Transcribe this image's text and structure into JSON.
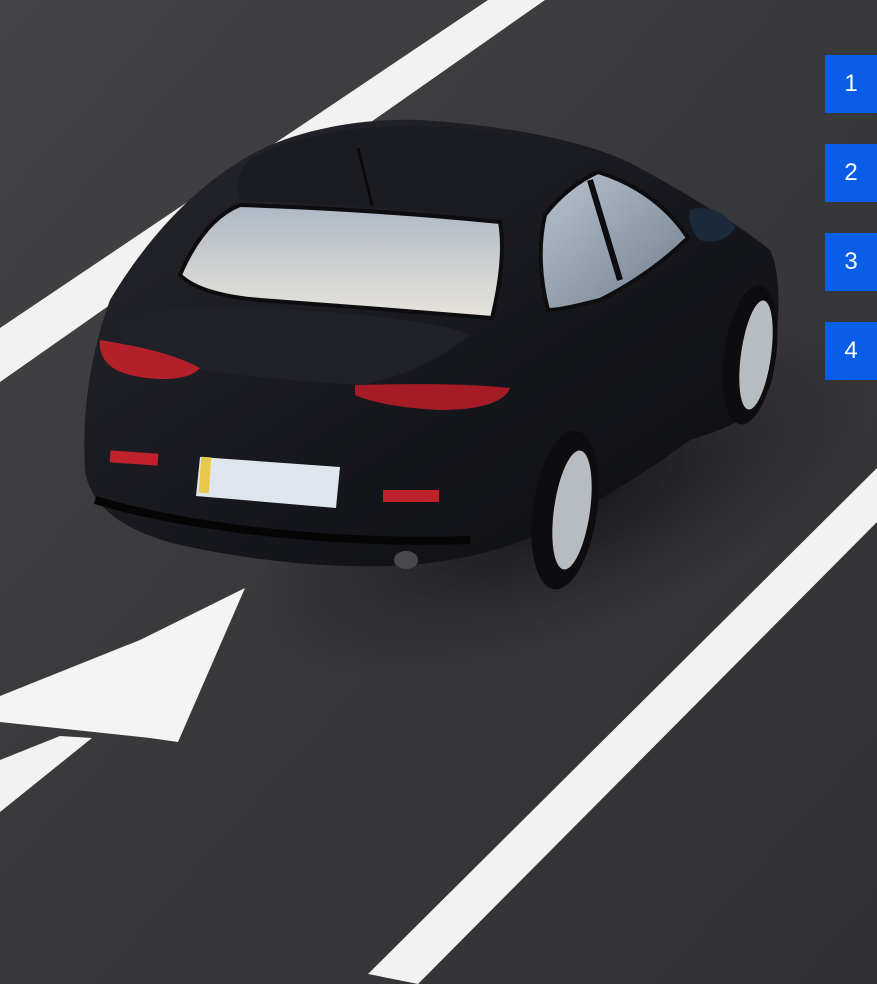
{
  "photo": {
    "subject": "car-on-road-photo",
    "road_color": "#3a3a3c",
    "marking_color": "#f2f2f2",
    "car_color": "#15161b"
  },
  "slide_nav": {
    "accent": "#0a5de6",
    "items": [
      {
        "label": "1"
      },
      {
        "label": "2"
      },
      {
        "label": "3"
      },
      {
        "label": "4"
      }
    ]
  }
}
